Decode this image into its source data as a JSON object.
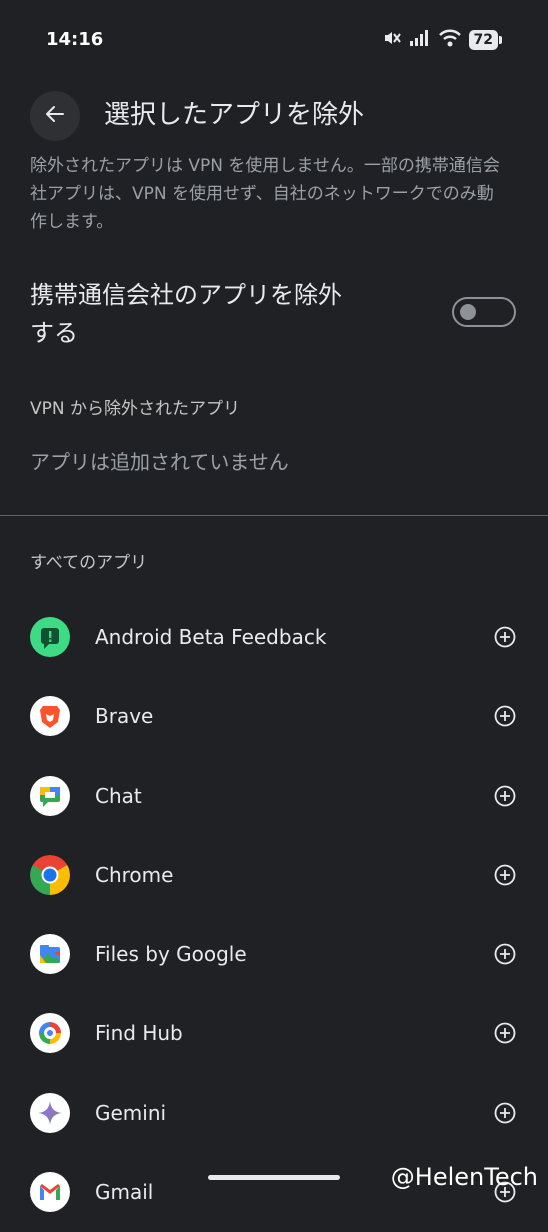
{
  "status_bar": {
    "time": "14:16",
    "battery": "72",
    "icons": [
      "mute-icon",
      "signal-icon",
      "wifi-icon",
      "battery-icon"
    ]
  },
  "header": {
    "back_icon": "arrow-left-icon",
    "title": "選択したアプリを除外"
  },
  "description": "除外されたアプリは VPN を使用しません。一部の携帯通信会社アプリは、VPN を使用せず、自社のネットワークでのみ動作します。",
  "carrier_toggle": {
    "label": "携帯通信会社のアプリを除外する",
    "enabled": false
  },
  "excluded_section": {
    "title": "VPN から除外されたアプリ",
    "empty_message": "アプリは追加されていません"
  },
  "all_apps_section": {
    "title": "すべてのアプリ",
    "add_icon": "plus-circle-icon",
    "apps": [
      {
        "name": "Android Beta Feedback",
        "icon": "android-beta-feedback-icon"
      },
      {
        "name": "Brave",
        "icon": "brave-icon"
      },
      {
        "name": "Chat",
        "icon": "google-chat-icon"
      },
      {
        "name": "Chrome",
        "icon": "chrome-icon"
      },
      {
        "name": "Files by Google",
        "icon": "files-by-google-icon"
      },
      {
        "name": "Find Hub",
        "icon": "find-hub-icon"
      },
      {
        "name": "Gemini",
        "icon": "gemini-icon"
      },
      {
        "name": "Gmail",
        "icon": "gmail-icon"
      }
    ]
  },
  "watermark": "@HelenTech",
  "colors": {
    "background": "#202124",
    "text_primary": "#e8eaed",
    "text_secondary": "#9aa0a6",
    "switch_off": "#8e9196"
  }
}
